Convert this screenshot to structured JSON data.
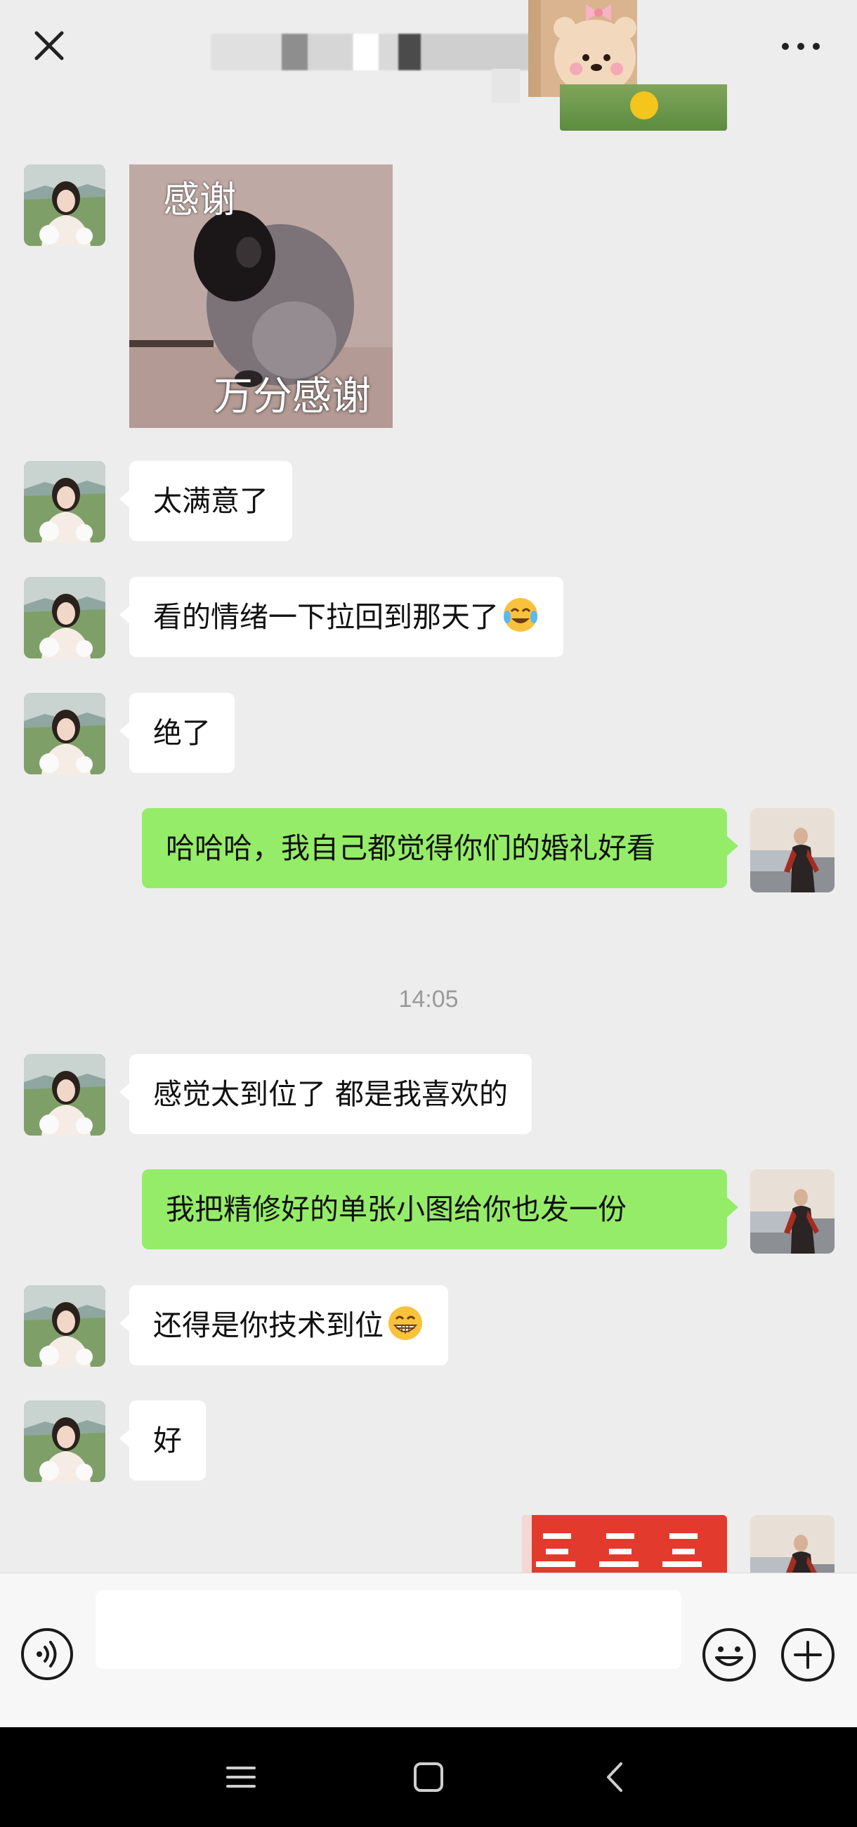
{
  "header": {
    "back_icon": "close-icon",
    "more_icon": "more-horizontal-icon"
  },
  "messages": [
    {
      "id": "m1",
      "side": "in",
      "type": "sticker",
      "top_text": "感谢",
      "bottom_text": "万分感谢"
    },
    {
      "id": "m2",
      "side": "in",
      "type": "text",
      "text": "太满意了"
    },
    {
      "id": "m3",
      "side": "in",
      "type": "text",
      "text": "看的情绪一下拉回到那天了",
      "emoji": "crying-laughing-emoji"
    },
    {
      "id": "m4",
      "side": "in",
      "type": "text",
      "text": "绝了"
    },
    {
      "id": "m5",
      "side": "out",
      "type": "text",
      "text": "哈哈哈，我自己都觉得你们的婚礼好看"
    },
    {
      "id": "m6",
      "side": "in",
      "type": "text",
      "text": "感觉太到位了 都是我喜欢的"
    },
    {
      "id": "m7",
      "side": "out",
      "type": "text",
      "text": "我把精修好的单张小图给你也发一份"
    },
    {
      "id": "m8",
      "side": "in",
      "type": "text",
      "text": "还得是你技术到位",
      "emoji": "grinning-emoji"
    },
    {
      "id": "m9",
      "side": "in",
      "type": "text",
      "text": "好"
    },
    {
      "id": "m10",
      "side": "out",
      "type": "image"
    }
  ],
  "timestamp": "14:05",
  "input": {
    "value": "",
    "voice_icon": "voice-icon",
    "emoji_icon": "smiley-icon",
    "plus_icon": "plus-circle-icon"
  },
  "navbar": {
    "menu_icon": "menu-icon",
    "home_icon": "home-square-icon",
    "back_icon": "back-chevron-icon"
  },
  "colors": {
    "background": "#ededed",
    "incoming_bubble": "#ffffff",
    "outgoing_bubble": "#95ec69",
    "timestamp": "#9a9a9a",
    "navbar": "#000000"
  }
}
